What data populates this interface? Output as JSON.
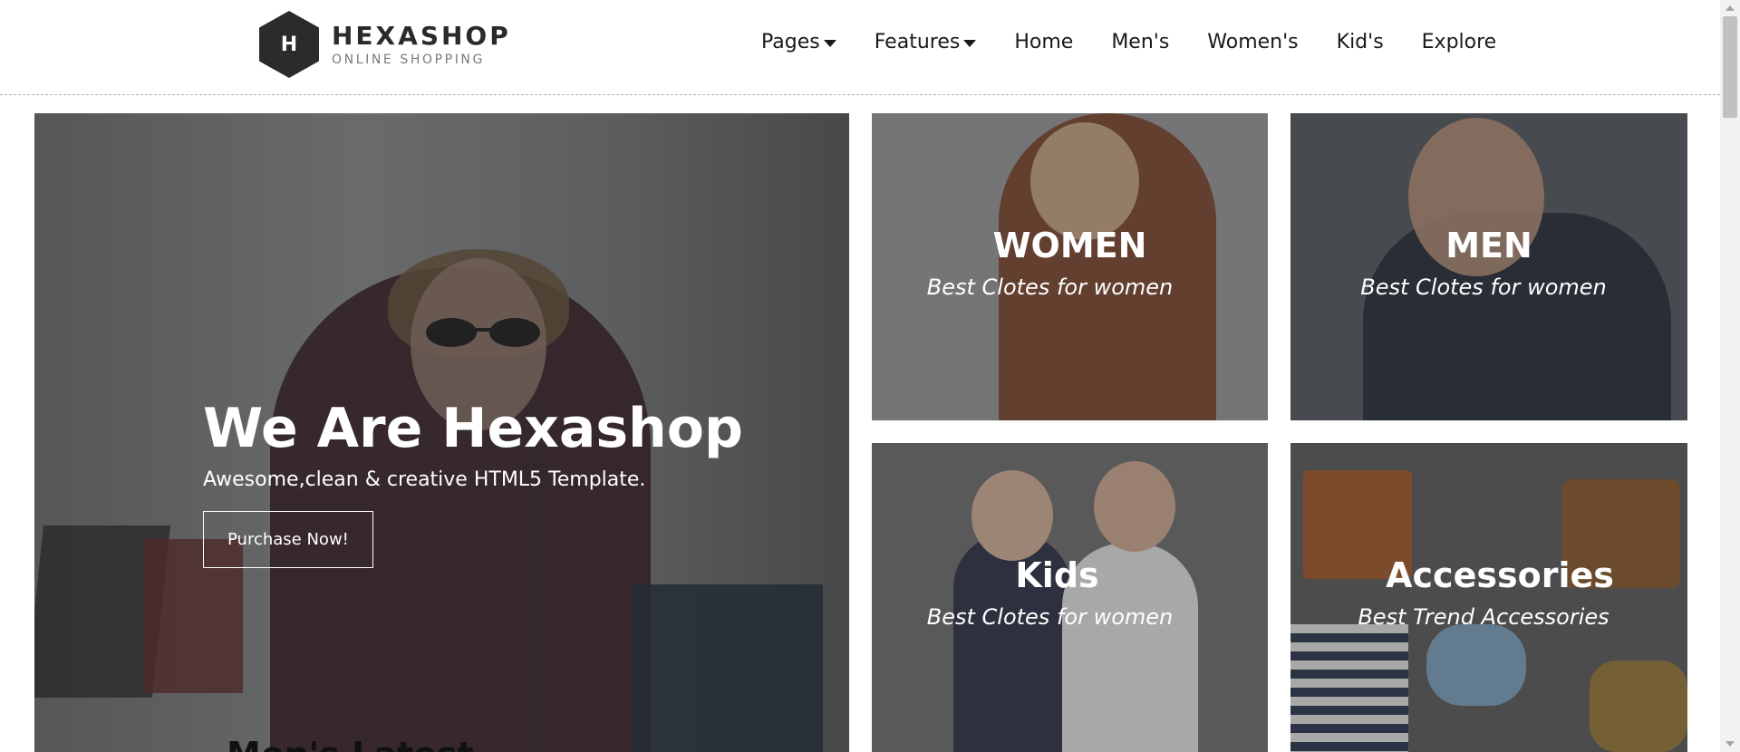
{
  "brand": {
    "letter": "H",
    "name": "HEXASHOP",
    "tagline": "ONLINE SHOPPING"
  },
  "nav": {
    "items": [
      {
        "label": "Pages",
        "dropdown": true
      },
      {
        "label": "Features",
        "dropdown": true
      },
      {
        "label": "Home",
        "dropdown": false
      },
      {
        "label": "Men's",
        "dropdown": false
      },
      {
        "label": "Women's",
        "dropdown": false
      },
      {
        "label": "Kid's",
        "dropdown": false
      },
      {
        "label": "Explore",
        "dropdown": false
      }
    ]
  },
  "hero": {
    "title": "We Are Hexashop",
    "subtitle": "Awesome,clean & creative HTML5 Template.",
    "button": "Purchase Now!",
    "below_peek": "Men's Latest"
  },
  "tiles": {
    "women": {
      "title": "WOMEN",
      "subtitle": "Best Clotes for women"
    },
    "men": {
      "title": "MEN",
      "subtitle": "Best Clotes for women"
    },
    "kids": {
      "title": "Kids",
      "subtitle": "Best Clotes for women"
    },
    "accessories": {
      "title": "Accessories",
      "subtitle": "Best Trend Accessories"
    }
  },
  "colors": {
    "text_dark": "#1a1a1a",
    "logo_hex": "#2b2b2b",
    "overlay_text": "#ffffff"
  }
}
